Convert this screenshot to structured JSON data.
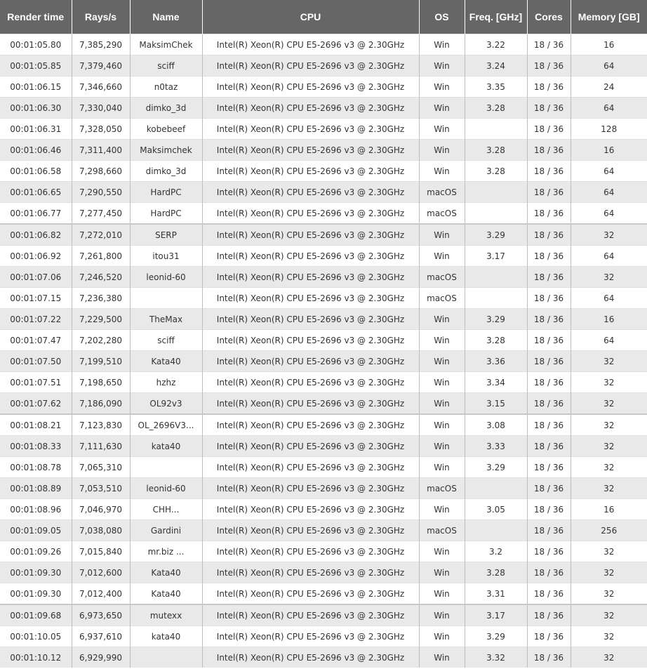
{
  "table": {
    "headers": [
      "Render time",
      "Rays/s",
      "Name",
      "CPU",
      "OS",
      "Freq. [GHz]",
      "Cores",
      "Memory [GB]"
    ],
    "rows": [
      [
        "00:01:05.80",
        "7,385,290",
        "MaksimChek",
        "Intel(R) Xeon(R) CPU E5-2696 v3 @ 2.30GHz",
        "Win",
        "3.22",
        "18 / 36",
        "16"
      ],
      [
        "00:01:05.85",
        "7,379,460",
        "sciff",
        "Intel(R) Xeon(R) CPU E5-2696 v3 @ 2.30GHz",
        "Win",
        "3.24",
        "18 / 36",
        "64"
      ],
      [
        "00:01:06.15",
        "7,346,660",
        "n0taz",
        "Intel(R) Xeon(R) CPU E5-2696 v3 @ 2.30GHz",
        "Win",
        "3.35",
        "18 / 36",
        "24"
      ],
      [
        "00:01:06.30",
        "7,330,040",
        "dimko_3d",
        "Intel(R) Xeon(R) CPU E5-2696 v3 @ 2.30GHz",
        "Win",
        "3.28",
        "18 / 36",
        "64"
      ],
      [
        "00:01:06.31",
        "7,328,050",
        "kobebeef",
        "Intel(R) Xeon(R) CPU E5-2696 v3 @ 2.30GHz",
        "Win",
        "",
        "18 / 36",
        "128"
      ],
      [
        "00:01:06.46",
        "7,311,400",
        "Maksimchek",
        "Intel(R) Xeon(R) CPU E5-2696 v3 @ 2.30GHz",
        "Win",
        "3.28",
        "18 / 36",
        "16"
      ],
      [
        "00:01:06.58",
        "7,298,660",
        "dimko_3d",
        "Intel(R) Xeon(R) CPU E5-2696 v3 @ 2.30GHz",
        "Win",
        "3.28",
        "18 / 36",
        "64"
      ],
      [
        "00:01:06.65",
        "7,290,550",
        "HardPC",
        "Intel(R) Xeon(R) CPU E5-2696 v3 @ 2.30GHz",
        "macOS",
        "",
        "18 / 36",
        "64"
      ],
      [
        "00:01:06.77",
        "7,277,450",
        "HardPC",
        "Intel(R) Xeon(R) CPU E5-2696 v3 @ 2.30GHz",
        "macOS",
        "",
        "18 / 36",
        "64"
      ],
      [
        "00:01:06.82",
        "7,272,010",
        "SERP",
        "Intel(R) Xeon(R) CPU E5-2696 v3 @ 2.30GHz",
        "Win",
        "3.29",
        "18 / 36",
        "32"
      ],
      [
        "00:01:06.92",
        "7,261,800",
        "itou31",
        "Intel(R) Xeon(R) CPU E5-2696 v3 @ 2.30GHz",
        "Win",
        "3.17",
        "18 / 36",
        "64"
      ],
      [
        "00:01:07.06",
        "7,246,520",
        "leonid-60",
        "Intel(R) Xeon(R) CPU E5-2696 v3 @ 2.30GHz",
        "macOS",
        "",
        "18 / 36",
        "32"
      ],
      [
        "00:01:07.15",
        "7,236,380",
        "",
        "Intel(R) Xeon(R) CPU E5-2696 v3 @ 2.30GHz",
        "macOS",
        "",
        "18 / 36",
        "64"
      ],
      [
        "00:01:07.22",
        "7,229,500",
        "TheMax",
        "Intel(R) Xeon(R) CPU E5-2696 v3 @ 2.30GHz",
        "Win",
        "3.29",
        "18 / 36",
        "16"
      ],
      [
        "00:01:07.47",
        "7,202,280",
        "sciff",
        "Intel(R) Xeon(R) CPU E5-2696 v3 @ 2.30GHz",
        "Win",
        "3.28",
        "18 / 36",
        "64"
      ],
      [
        "00:01:07.50",
        "7,199,510",
        "Kata40",
        "Intel(R) Xeon(R) CPU E5-2696 v3 @ 2.30GHz",
        "Win",
        "3.36",
        "18 / 36",
        "32"
      ],
      [
        "00:01:07.51",
        "7,198,650",
        "hzhz",
        "Intel(R) Xeon(R) CPU E5-2696 v3 @ 2.30GHz",
        "Win",
        "3.34",
        "18 / 36",
        "32"
      ],
      [
        "00:01:07.62",
        "7,186,090",
        "OL92v3",
        "Intel(R) Xeon(R) CPU E5-2696 v3 @ 2.30GHz",
        "Win",
        "3.15",
        "18 / 36",
        "32"
      ],
      [
        "00:01:08.21",
        "7,123,830",
        "OL_2696V3...",
        "Intel(R) Xeon(R) CPU E5-2696 v3 @ 2.30GHz",
        "Win",
        "3.08",
        "18 / 36",
        "32"
      ],
      [
        "00:01:08.33",
        "7,111,630",
        "kata40",
        "Intel(R) Xeon(R) CPU E5-2696 v3 @ 2.30GHz",
        "Win",
        "3.33",
        "18 / 36",
        "32"
      ],
      [
        "00:01:08.78",
        "7,065,310",
        "",
        "Intel(R) Xeon(R) CPU E5-2696 v3 @ 2.30GHz",
        "Win",
        "3.29",
        "18 / 36",
        "32"
      ],
      [
        "00:01:08.89",
        "7,053,510",
        "leonid-60",
        "Intel(R) Xeon(R) CPU E5-2696 v3 @ 2.30GHz",
        "macOS",
        "",
        "18 / 36",
        "32"
      ],
      [
        "00:01:08.96",
        "7,046,970",
        "CHH...",
        "Intel(R) Xeon(R) CPU E5-2696 v3 @ 2.30GHz",
        "Win",
        "3.05",
        "18 / 36",
        "16"
      ],
      [
        "00:01:09.05",
        "7,038,080",
        "Gardini",
        "Intel(R) Xeon(R) CPU E5-2696 v3 @ 2.30GHz",
        "macOS",
        "",
        "18 / 36",
        "256"
      ],
      [
        "00:01:09.26",
        "7,015,840",
        "mr.biz ...",
        "Intel(R) Xeon(R) CPU E5-2696 v3 @ 2.30GHz",
        "Win",
        "3.2",
        "18 / 36",
        "32"
      ],
      [
        "00:01:09.30",
        "7,012,600",
        "Kata40",
        "Intel(R) Xeon(R) CPU E5-2696 v3 @ 2.30GHz",
        "Win",
        "3.28",
        "18 / 36",
        "32"
      ],
      [
        "00:01:09.30",
        "7,012,400",
        "Kata40",
        "Intel(R) Xeon(R) CPU E5-2696 v3 @ 2.30GHz",
        "Win",
        "3.31",
        "18 / 36",
        "32"
      ],
      [
        "00:01:09.68",
        "6,973,650",
        "mutexx",
        "Intel(R) Xeon(R) CPU E5-2696 v3 @ 2.30GHz",
        "Win",
        "3.17",
        "18 / 36",
        "32"
      ],
      [
        "00:01:10.05",
        "6,937,610",
        "kata40",
        "Intel(R) Xeon(R) CPU E5-2696 v3 @ 2.30GHz",
        "Win",
        "3.29",
        "18 / 36",
        "32"
      ],
      [
        "00:01:10.12",
        "6,929,990",
        "",
        "Intel(R) Xeon(R) CPU E5-2696 v3 @ 2.30GHz",
        "Win",
        "3.32",
        "18 / 36",
        "32"
      ]
    ]
  }
}
